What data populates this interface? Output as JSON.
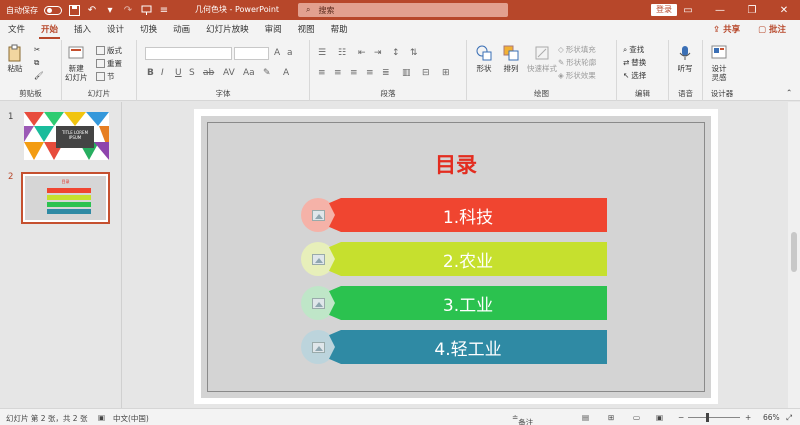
{
  "titlebar": {
    "autosave_label": "自动保存",
    "autosave_state": "关",
    "doc_title": "几何色块 - PowerPoint",
    "search_placeholder": "搜索",
    "login_label": "登录"
  },
  "tabs": [
    {
      "label": "文件"
    },
    {
      "label": "开始"
    },
    {
      "label": "插入"
    },
    {
      "label": "设计"
    },
    {
      "label": "切换"
    },
    {
      "label": "动画"
    },
    {
      "label": "幻灯片放映"
    },
    {
      "label": "审阅"
    },
    {
      "label": "视图"
    },
    {
      "label": "帮助"
    }
  ],
  "share_label": "共享",
  "comment_label": "批注",
  "ribbon": {
    "clipboard": {
      "paste": "粘贴",
      "label": "剪贴板"
    },
    "slides": {
      "new_slide": "新建\n幻灯片",
      "layout": "版式",
      "reset": "重置",
      "section": "节",
      "label": "幻灯片"
    },
    "font": {
      "label": "字体"
    },
    "paragraph": {
      "label": "段落"
    },
    "drawing": {
      "shapes": "形状",
      "arrange": "排列",
      "quick_styles": "快速样式",
      "fill": "形状填充",
      "outline": "形状轮廓",
      "effects": "形状效果",
      "label": "绘图"
    },
    "editing": {
      "find": "查找",
      "replace": "替换",
      "select": "选择",
      "label": "编辑"
    },
    "voice": {
      "dictate": "听写",
      "label": "语音"
    },
    "designer": {
      "design_ideas": "设计\n灵感",
      "label": "设计器"
    }
  },
  "thumbnails": [
    {
      "number": "1",
      "title": "TITLE LOREM IPSUM"
    },
    {
      "number": "2",
      "title": "目录"
    }
  ],
  "slide": {
    "title": "目录",
    "items": [
      {
        "label": "1.科技",
        "color": "#f04530",
        "circle": "#f5b2a8"
      },
      {
        "label": "2.农业",
        "color": "#c6e02e",
        "circle": "#e7efba"
      },
      {
        "label": "3.工业",
        "color": "#2bc24f",
        "circle": "#bfe6c8"
      },
      {
        "label": "4.轻工业",
        "color": "#2f8aa4",
        "circle": "#bcd4dc"
      }
    ]
  },
  "statusbar": {
    "slide_info": "幻灯片 第 2 张，共 2 张",
    "language": "中文(中国)",
    "notes": "备注",
    "zoom": "66%"
  },
  "colors": {
    "accent": "#b7472a",
    "title_red": "#e32c1f"
  }
}
